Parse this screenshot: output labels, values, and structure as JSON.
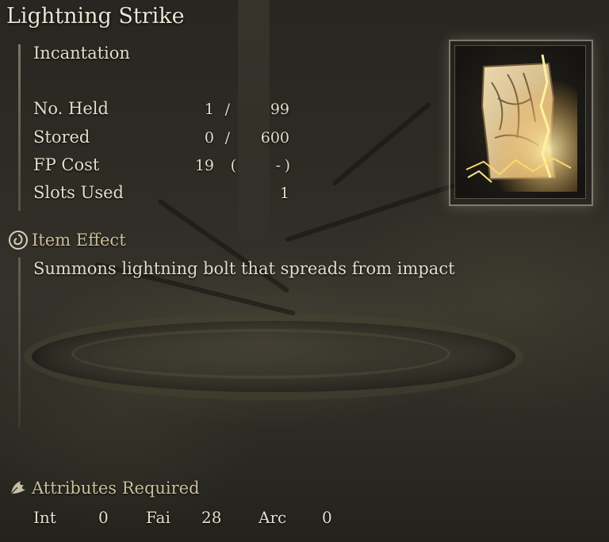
{
  "item": {
    "name": "Lightning Strike",
    "category": "Incantation",
    "image_icon": "scroll-with-lightning-icon"
  },
  "stats": {
    "held": {
      "label": "No. Held",
      "current": "1",
      "sep": "/",
      "max": "99"
    },
    "stored": {
      "label": "Stored",
      "current": "0",
      "sep": "/",
      "max": "600"
    },
    "fp_cost": {
      "label": "FP Cost",
      "value": "19",
      "open": "(",
      "alt": "-",
      "close": ")"
    },
    "slots": {
      "label": "Slots Used",
      "value": "1"
    }
  },
  "item_effect": {
    "header": "Item Effect",
    "icon": "effect-swirl-icon",
    "text": "Summons lightning bolt that spreads from impact"
  },
  "attributes": {
    "header": "Attributes Required",
    "icon": "feather-hand-icon",
    "int": {
      "label": "Int",
      "value": "0"
    },
    "fai": {
      "label": "Fai",
      "value": "28"
    },
    "arc": {
      "label": "Arc",
      "value": "0"
    }
  },
  "colors": {
    "text": "#e3ddcc",
    "header": "#ccbf9a",
    "frame": "#c8c3af"
  }
}
